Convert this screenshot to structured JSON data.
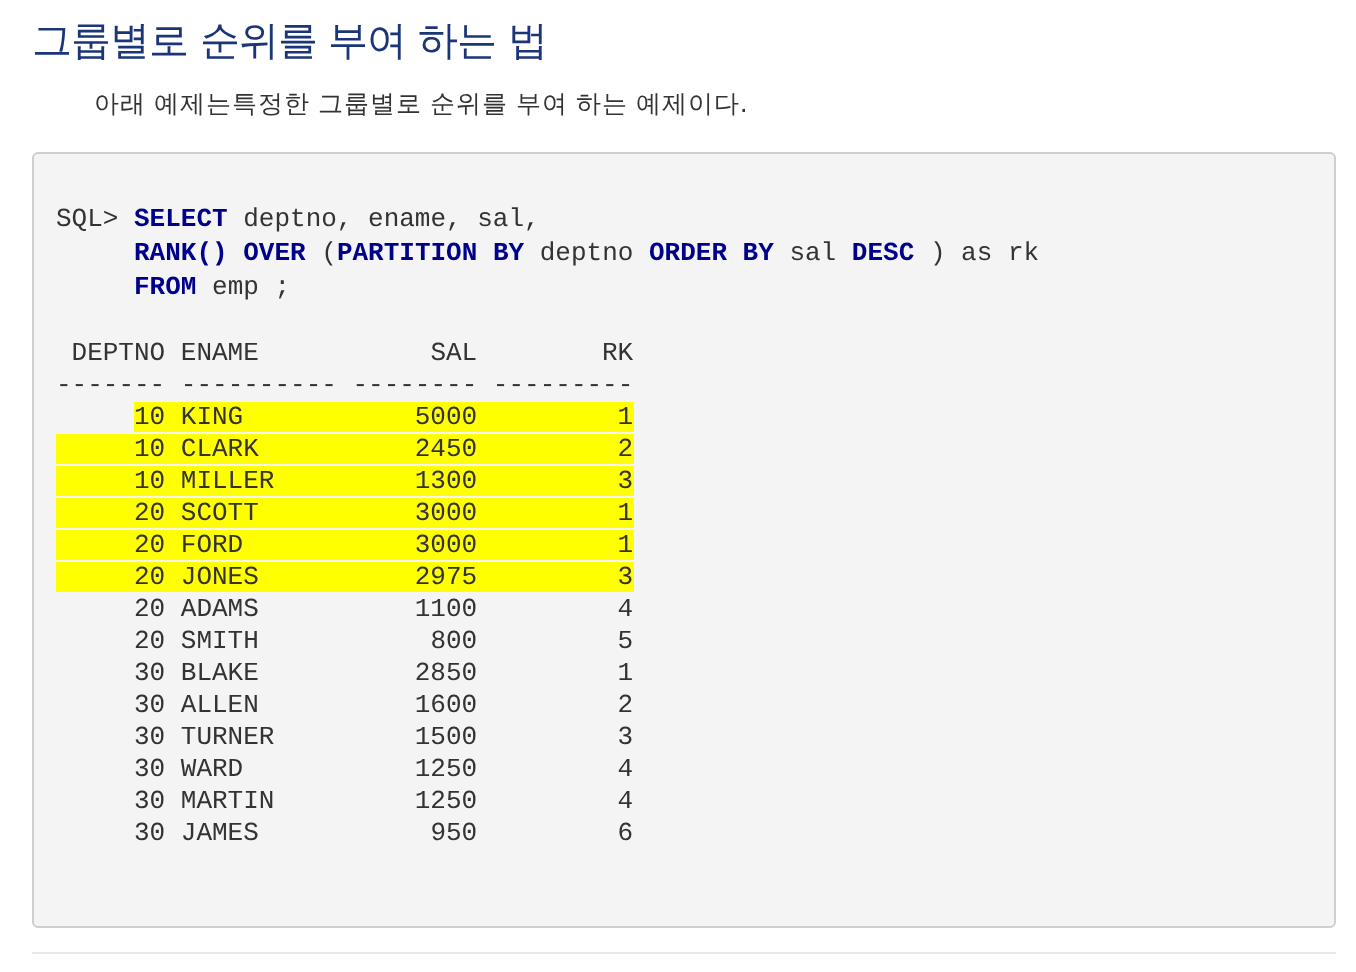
{
  "title": "그룹별로 순위를 부여 하는 법",
  "intro": "아래 예제는특정한 그룹별로 순위를 부여 하는 예제이다.",
  "query": [
    {
      "prompt": "SQL>",
      "segments": [
        {
          "kind": "keyword",
          "text": "SELECT"
        },
        {
          "kind": "plain",
          "text": " deptno, ename, sal,"
        }
      ]
    },
    {
      "segments": [
        {
          "kind": "keyword",
          "text": "RANK() OVER"
        },
        {
          "kind": "plain",
          "text": " ("
        },
        {
          "kind": "keyword",
          "text": "PARTITION BY"
        },
        {
          "kind": "plain",
          "text": " deptno "
        },
        {
          "kind": "keyword",
          "text": "ORDER BY"
        },
        {
          "kind": "plain",
          "text": " sal "
        },
        {
          "kind": "keyword",
          "text": "DESC"
        },
        {
          "kind": "plain",
          "text": " ) as rk"
        }
      ]
    },
    {
      "segments": [
        {
          "kind": "keyword",
          "text": "FROM"
        },
        {
          "kind": "plain",
          "text": " emp ;"
        }
      ]
    }
  ],
  "columns": [
    "DEPTNO",
    "ENAME",
    "SAL",
    "RK"
  ],
  "separator": "------- ---------- -------- ---------",
  "rows": [
    {
      "deptno": "10",
      "ename": "KING",
      "sal": "5000",
      "rk": "1",
      "highlighted": true,
      "highlight_from_text": true
    },
    {
      "deptno": "10",
      "ename": "CLARK",
      "sal": "2450",
      "rk": "2",
      "highlighted": true,
      "highlight_from_text": false
    },
    {
      "deptno": "10",
      "ename": "MILLER",
      "sal": "1300",
      "rk": "3",
      "highlighted": true,
      "highlight_from_text": false
    },
    {
      "deptno": "20",
      "ename": "SCOTT",
      "sal": "3000",
      "rk": "1",
      "highlighted": true,
      "highlight_from_text": false
    },
    {
      "deptno": "20",
      "ename": "FORD",
      "sal": "3000",
      "rk": "1",
      "highlighted": true,
      "highlight_from_text": false
    },
    {
      "deptno": "20",
      "ename": "JONES",
      "sal": "2975",
      "rk": "3",
      "highlighted": true,
      "highlight_from_text": false
    },
    {
      "deptno": "20",
      "ename": "ADAMS",
      "sal": "1100",
      "rk": "4",
      "highlighted": false
    },
    {
      "deptno": "20",
      "ename": "SMITH",
      "sal": "800",
      "rk": "5",
      "highlighted": false
    },
    {
      "deptno": "30",
      "ename": "BLAKE",
      "sal": "2850",
      "rk": "1",
      "highlighted": false
    },
    {
      "deptno": "30",
      "ename": "ALLEN",
      "sal": "1600",
      "rk": "2",
      "highlighted": false
    },
    {
      "deptno": "30",
      "ename": "TURNER",
      "sal": "1500",
      "rk": "3",
      "highlighted": false
    },
    {
      "deptno": "30",
      "ename": "WARD",
      "sal": "1250",
      "rk": "4",
      "highlighted": false
    },
    {
      "deptno": "30",
      "ename": "MARTIN",
      "sal": "1250",
      "rk": "4",
      "highlighted": false
    },
    {
      "deptno": "30",
      "ename": "JAMES",
      "sal": "950",
      "rk": "6",
      "highlighted": false
    }
  ]
}
